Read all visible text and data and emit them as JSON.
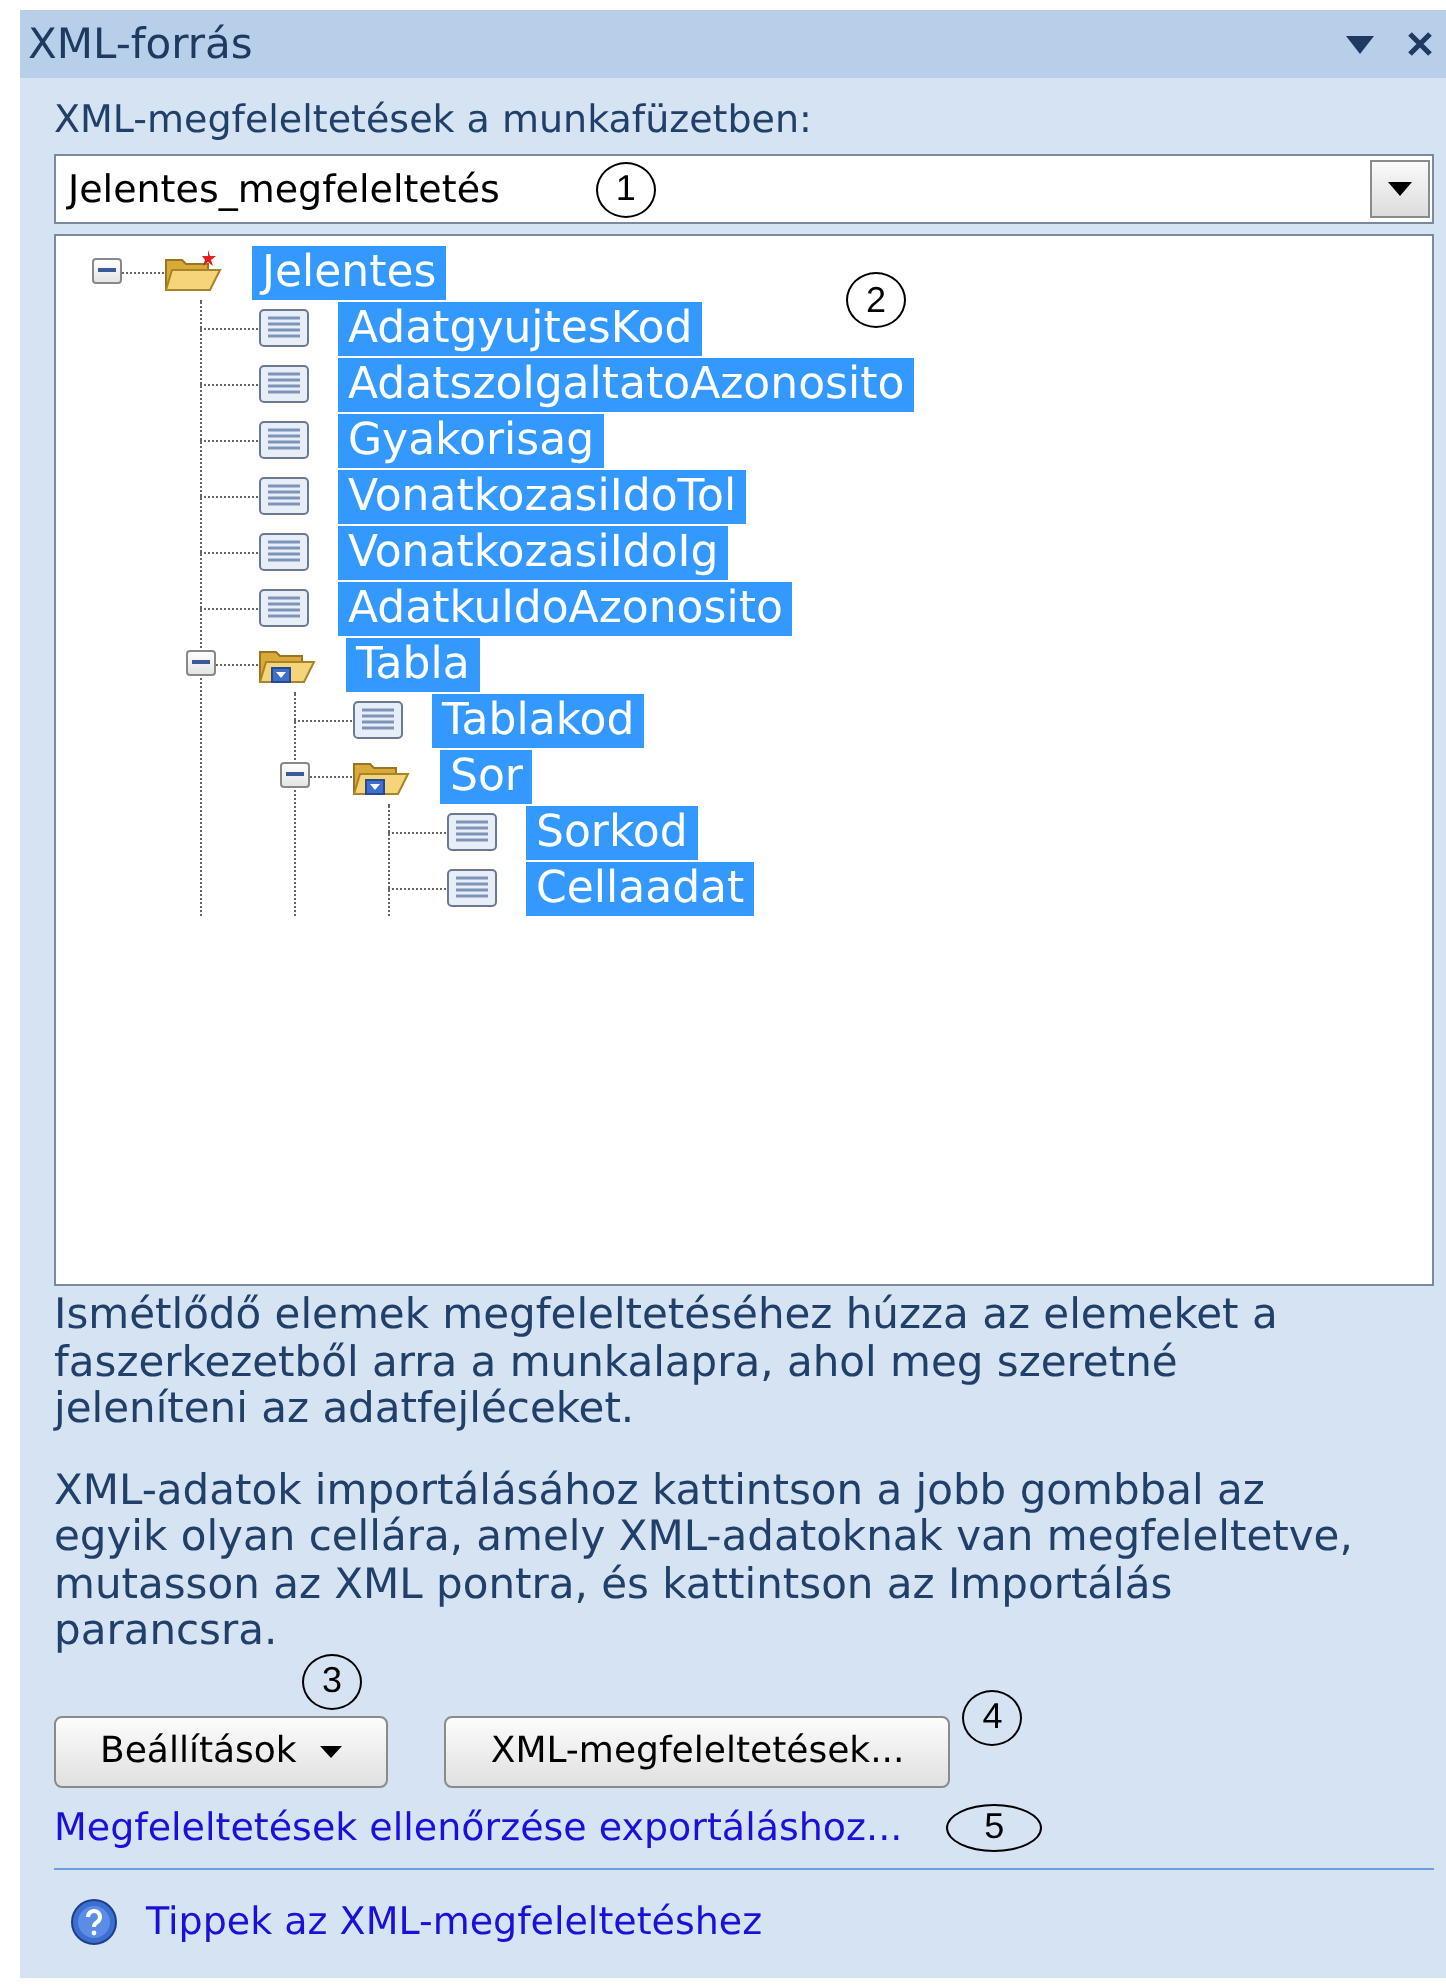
{
  "panel": {
    "title": "XML-forrás"
  },
  "maps_label": "XML-megfeleltetések a munkafüzetben:",
  "map_select": {
    "value": "Jelentes_megfeleltetés",
    "callout": "1"
  },
  "tree": {
    "callout": "2",
    "nodes": [
      {
        "label": "Jelentes",
        "kind": "root",
        "expanded": true,
        "selected": true,
        "children": [
          {
            "label": "AdatgyujtesKod",
            "kind": "element",
            "selected": true
          },
          {
            "label": "AdatszolgaltatoAzonosito",
            "kind": "element",
            "selected": true
          },
          {
            "label": "Gyakorisag",
            "kind": "element",
            "selected": true
          },
          {
            "label": "VonatkozasiIdoTol",
            "kind": "element",
            "selected": true
          },
          {
            "label": "VonatkozasiIdoIg",
            "kind": "element",
            "selected": true
          },
          {
            "label": "AdatkuldoAzonosito",
            "kind": "element",
            "selected": true
          },
          {
            "label": "Tabla",
            "kind": "folder",
            "expanded": true,
            "selected": true,
            "children": [
              {
                "label": "Tablakod",
                "kind": "element",
                "selected": true
              },
              {
                "label": "Sor",
                "kind": "folder",
                "expanded": true,
                "selected": true,
                "children": [
                  {
                    "label": "Sorkod",
                    "kind": "element",
                    "selected": true
                  },
                  {
                    "label": "Cellaadat",
                    "kind": "element",
                    "selected": true
                  }
                ]
              }
            ]
          }
        ]
      }
    ]
  },
  "hint_repeating": "Ismétlődő elemek megfeleltetéséhez húzza az elemeket a faszerkezetből arra a munkalapra, ahol meg szeretné jeleníteni az adatfejléceket.",
  "hint_import": "XML-adatok importálásához kattintson a jobb gombbal az egyik olyan cellára, amely XML-adatoknak van megfeleltetve, mutasson az XML pontra, és kattintson az Importálás parancsra.",
  "hint_callout": "3",
  "buttons": [
    {
      "label": "Beállítások",
      "kind": "menu"
    },
    {
      "label": "XML-megfeleltetések...",
      "kind": "plain"
    }
  ],
  "buttons_callout": "4",
  "verify_link": {
    "label": "Megfeleltetések ellenőrzése exportáláshoz...",
    "callout": "5"
  },
  "tips_link": "Tippek az XML-megfeleltetéshez"
}
